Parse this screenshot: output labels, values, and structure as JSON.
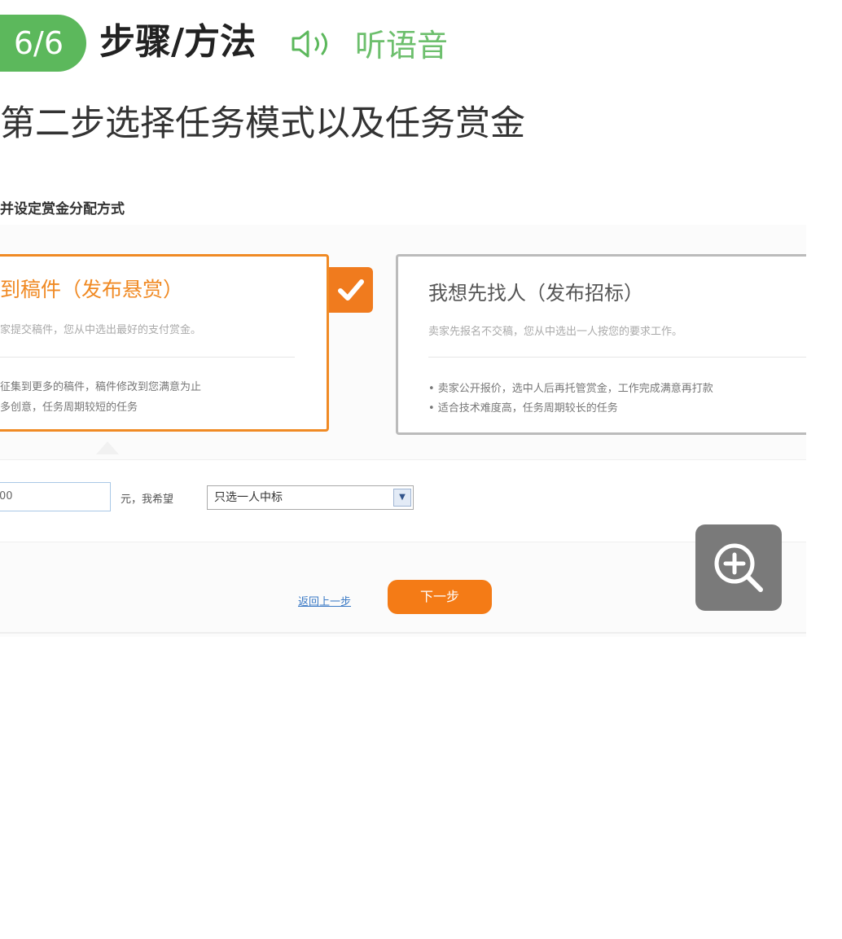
{
  "header": {
    "step_badge": "6/6",
    "title": "步骤/方法",
    "listen_label": "听语音",
    "speaker_icon": "speaker-icon"
  },
  "step": {
    "description": "第二步选择任务模式以及任务赏金"
  },
  "screenshot": {
    "heading": "并设定赏金分配方式",
    "option_left": {
      "title": "到稿件（发布悬赏）",
      "subtitle": "家提交稿件，您从中选出最好的支付赏金。",
      "bullet1": "征集到更多的稿件，稿件修改到您满意为止",
      "bullet2": "多创意，任务周期较短的任务",
      "selected": true
    },
    "option_right": {
      "title": "我想先找人（发布招标）",
      "subtitle": "卖家先报名不交稿，您从中选出一人按您的要求工作。",
      "bullet1": "• 卖家公开报价，选中人后再托管赏金，工作完成满意再打款",
      "bullet2": "• 适合技术难度高，任务周期较长的任务"
    },
    "amount_value": "00",
    "unit_text": "元，我希望",
    "mode_select_value": "只选一人中标",
    "back_link": "返回上一步",
    "next_button": "下一步"
  },
  "zoom": {
    "icon": "zoom-in-icon"
  },
  "colors": {
    "green": "#5cb85c",
    "orange": "#f08a24",
    "zoom_bg": "#7a7a7a"
  }
}
